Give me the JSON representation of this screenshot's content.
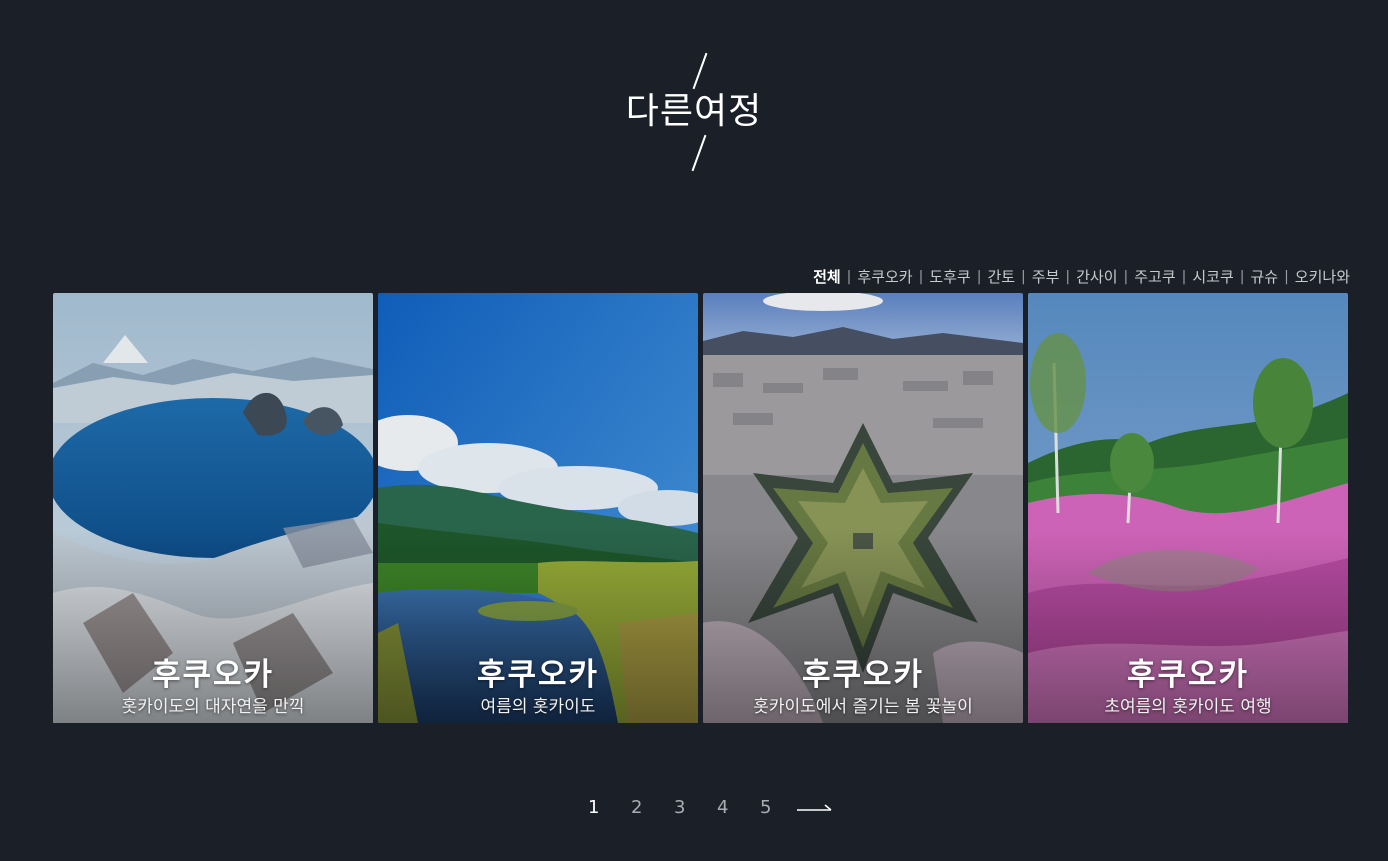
{
  "header": {
    "title": "다른여정"
  },
  "filters": [
    {
      "label": "전체",
      "active": true
    },
    {
      "label": "후쿠오카",
      "active": false
    },
    {
      "label": "도후쿠",
      "active": false
    },
    {
      "label": "간토",
      "active": false
    },
    {
      "label": "주부",
      "active": false
    },
    {
      "label": "간사이",
      "active": false
    },
    {
      "label": "주고쿠",
      "active": false
    },
    {
      "label": "시코쿠",
      "active": false
    },
    {
      "label": "규슈",
      "active": false
    },
    {
      "label": "오키나와",
      "active": false
    }
  ],
  "filter_separator": "|",
  "cards": [
    {
      "title": "후쿠오카",
      "subtitle": "홋카이도의 대자연을 만끽",
      "image": "snowy-lake-mountain-image"
    },
    {
      "title": "후쿠오카",
      "subtitle": "여름의 홋카이도",
      "image": "summer-wetland-lake-image"
    },
    {
      "title": "후쿠오카",
      "subtitle": "홋카이도에서 즐기는 봄 꽃놀이",
      "image": "star-fort-city-image"
    },
    {
      "title": "후쿠오카",
      "subtitle": "초여름의 홋카이도 여행",
      "image": "pink-moss-phlox-hill-image"
    }
  ],
  "pagination": {
    "pages": [
      "1",
      "2",
      "3",
      "4",
      "5"
    ],
    "current": "1",
    "next_icon": "long-arrow-right-icon"
  }
}
